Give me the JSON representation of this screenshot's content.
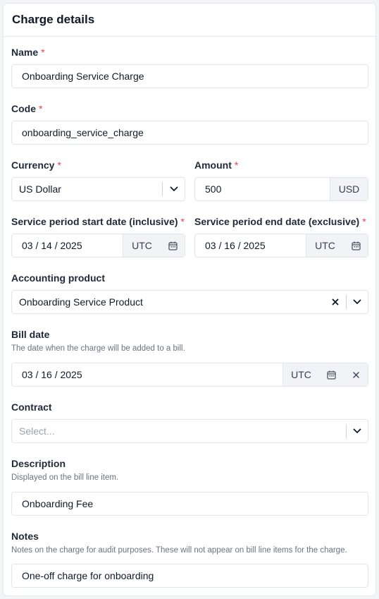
{
  "panel": {
    "title": "Charge details"
  },
  "name": {
    "label": "Name",
    "value": "Onboarding Service Charge"
  },
  "code": {
    "label": "Code",
    "value": "onboarding_service_charge"
  },
  "currency": {
    "label": "Currency",
    "value": "US Dollar"
  },
  "amount": {
    "label": "Amount",
    "value": "500",
    "unit": "USD"
  },
  "start_date": {
    "label": "Service period start date (inclusive)",
    "value": "03 / 14 / 2025",
    "tz": "UTC"
  },
  "end_date": {
    "label": "Service period end date (exclusive)",
    "value": "03 / 16 / 2025",
    "tz": "UTC"
  },
  "accounting_product": {
    "label": "Accounting product",
    "value": "Onboarding Service Product"
  },
  "bill_date": {
    "label": "Bill date",
    "hint": "The date when the charge will be added to a bill.",
    "value": "03 / 16 / 2025",
    "tz": "UTC"
  },
  "contract": {
    "label": "Contract",
    "placeholder": "Select..."
  },
  "description": {
    "label": "Description",
    "hint": "Displayed on the bill line item.",
    "value": "Onboarding Fee"
  },
  "notes": {
    "label": "Notes",
    "hint": "Notes on the charge for audit purposes. These will not appear on bill line items for the charge.",
    "value": "One-off charge for onboarding"
  },
  "required_mark": "*",
  "icons": {
    "calendar": "calendar-icon",
    "chevron": "chevron-down-icon",
    "clear": "close-icon"
  },
  "colors": {
    "required": "#ef4444",
    "addon_bg": "#f1f3f6",
    "border": "#e2e5ea"
  }
}
